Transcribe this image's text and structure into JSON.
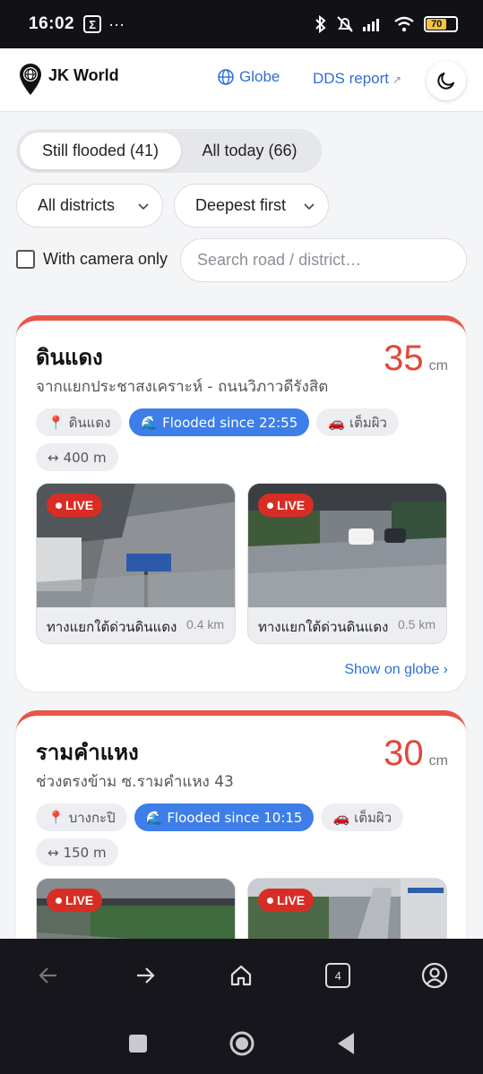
{
  "status_bar": {
    "time": "16:02",
    "app_icon": "Σ",
    "dots": "···",
    "battery": "70"
  },
  "header": {
    "logo_text": "JK World",
    "globe_label": "Globe",
    "dds_label": "DDS report",
    "dds_arrow": "↗"
  },
  "filters": {
    "tabs": [
      {
        "label": "Still flooded (41)",
        "active": true
      },
      {
        "label": "All today (66)",
        "active": false
      }
    ],
    "district_select": "All districts",
    "sort_select": "Deepest first",
    "camera_only_label": "With camera only",
    "search_placeholder": "Search road / district…"
  },
  "cards": [
    {
      "title": "ดินแดง",
      "subtitle": "จากแยกประชาสงเคราะห์ - ถนนวิภาวดีรังสิต",
      "depth": "35",
      "unit": "cm",
      "chips": {
        "district": "ดินแดง",
        "since": "Flooded since 22:55",
        "level": "เต็มผิว",
        "length": "400 m"
      },
      "cameras": [
        {
          "live": "LIVE",
          "name": "ทางแยกใต้ด่วนดินแดง",
          "dist": "0.4 km"
        },
        {
          "live": "LIVE",
          "name": "ทางแยกใต้ด่วนดินแดง",
          "dist": "0.5 km"
        }
      ],
      "globe_link": "Show on globe ›"
    },
    {
      "title": "รามคำแหง",
      "subtitle": "ช่วงตรงข้าม ซ.รามคำแหง 43",
      "depth": "30",
      "unit": "cm",
      "chips": {
        "district": "บางกะปิ",
        "since": "Flooded since 10:15",
        "level": "เต็มผิว",
        "length": "150 m"
      },
      "cameras": [
        {
          "live": "LIVE"
        },
        {
          "live": "LIVE"
        }
      ]
    }
  ],
  "browser": {
    "tab_count": "4"
  },
  "icons": [
    "back-arrow-icon",
    "forward-arrow-icon",
    "home-icon",
    "tabs-icon",
    "account-icon",
    "moon-icon",
    "globe-icon",
    "pin-icon",
    "car-icon",
    "wave-icon",
    "chevron-down-icon"
  ],
  "colors": {
    "accent": "#2f6fd6",
    "depth": "#e0483c",
    "flood_chip": "#3d7ee8",
    "live": "#d82d24"
  }
}
